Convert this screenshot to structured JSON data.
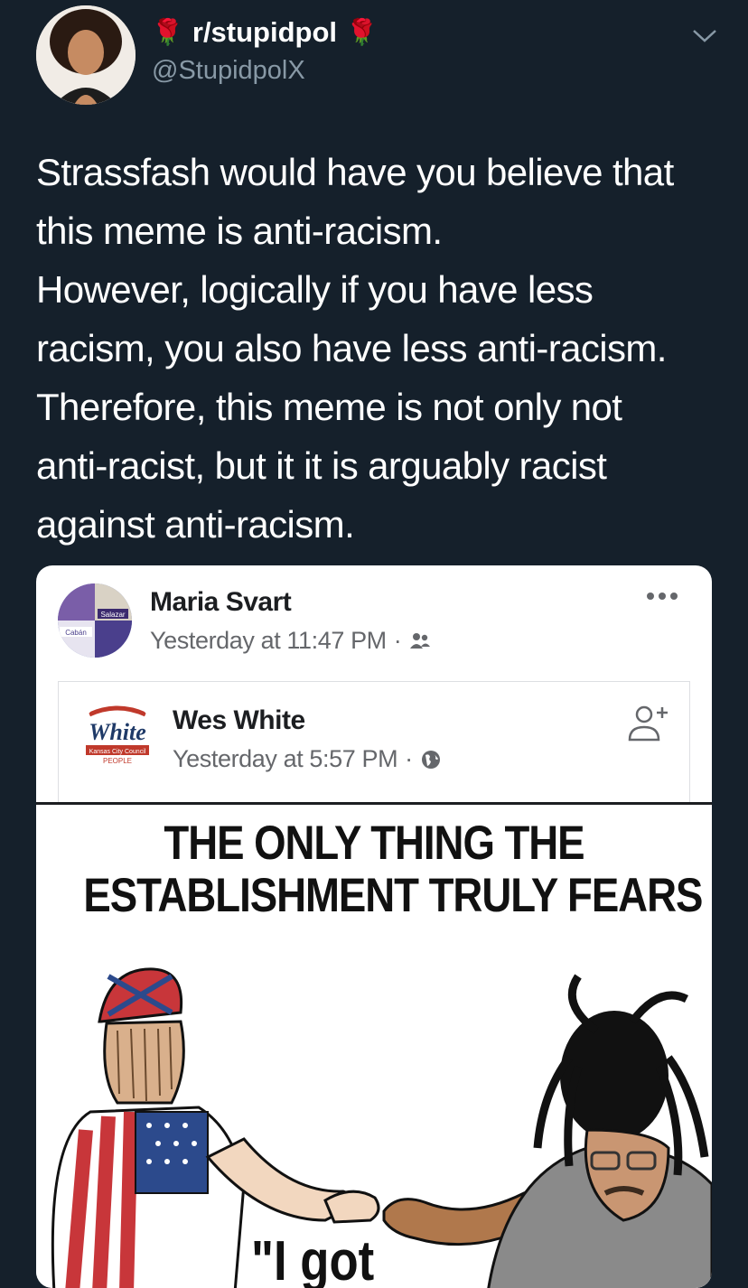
{
  "tweet": {
    "display_name": "r/stupidpol",
    "handle": "@StupidpolX",
    "text_lines": [
      "Strassfash would have you believe that",
      "this meme is anti-racism.",
      "However, logically if you have less",
      "racism, you also have less anti-racism.",
      "Therefore, this meme is not only not",
      "anti-racist, but it it is arguably racist",
      "against anti-racism."
    ]
  },
  "fb_post": {
    "author": "Maria Svart",
    "time": "Yesterday at 11:47 PM",
    "audience_icon": "friends-icon",
    "avatar_labels": [
      "Salazar",
      "Cabán"
    ]
  },
  "shared_post": {
    "author": "Wes White",
    "time": "Yesterday at 5:57 PM",
    "audience_icon": "globe-icon",
    "avatar_label": "White",
    "avatar_sub": "Kansas City Council",
    "avatar_sub2": "PEOPLE"
  },
  "meme": {
    "title_line1": "THE ONLY THING THE",
    "title_line2": "ESTABLISHMENT TRULY FEARS",
    "caption": "\"I got"
  },
  "colors": {
    "background": "#15202b",
    "secondary_text": "#8899a6",
    "fb_gray": "#65676b"
  }
}
